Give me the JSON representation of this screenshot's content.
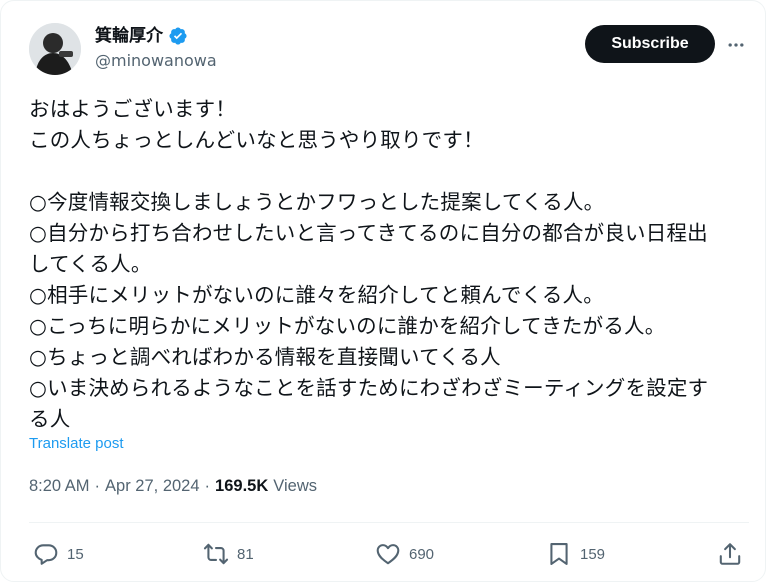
{
  "author": {
    "display_name": "箕輪厚介",
    "handle": "@minowanowa",
    "verified_icon": "verified-badge-icon",
    "avatar_icon": "avatar"
  },
  "header": {
    "subscribe_label": "Subscribe",
    "more_icon": "more-icon"
  },
  "tweet": {
    "lines": [
      "おはようございます！",
      "この人ちょっとしんどいなと思うやり取りです！",
      "",
      "○今度情報交換しましょうとかフワっとした提案してくる人。",
      "○自分から打ち合わせしたいと言ってきてるのに自分の都合が良い日程出",
      "してくる人。",
      "○相手にメリットがないのに誰々を紹介してと頼んでくる人。",
      "○こっちに明らかにメリットがないのに誰かを紹介してきたがる人。",
      "○ちょっと調べればわかる情報を直接聞いてくる人",
      "○いま決められるようなことを話すためにわざわざミーティングを設定す",
      "る人"
    ],
    "translate_label": "Translate post",
    "time": "8:20 AM",
    "separator": "·",
    "date": "Apr 27, 2024",
    "views_count": "169.5K",
    "views_label": "Views"
  },
  "actions": {
    "replies": "15",
    "reposts": "81",
    "likes": "690",
    "bookmarks": "159"
  },
  "colors": {
    "text": "#0f1419",
    "secondary": "#536471",
    "link": "#1d9bf0",
    "verified": "#1d9bf0",
    "button_bg": "#0f1419"
  }
}
